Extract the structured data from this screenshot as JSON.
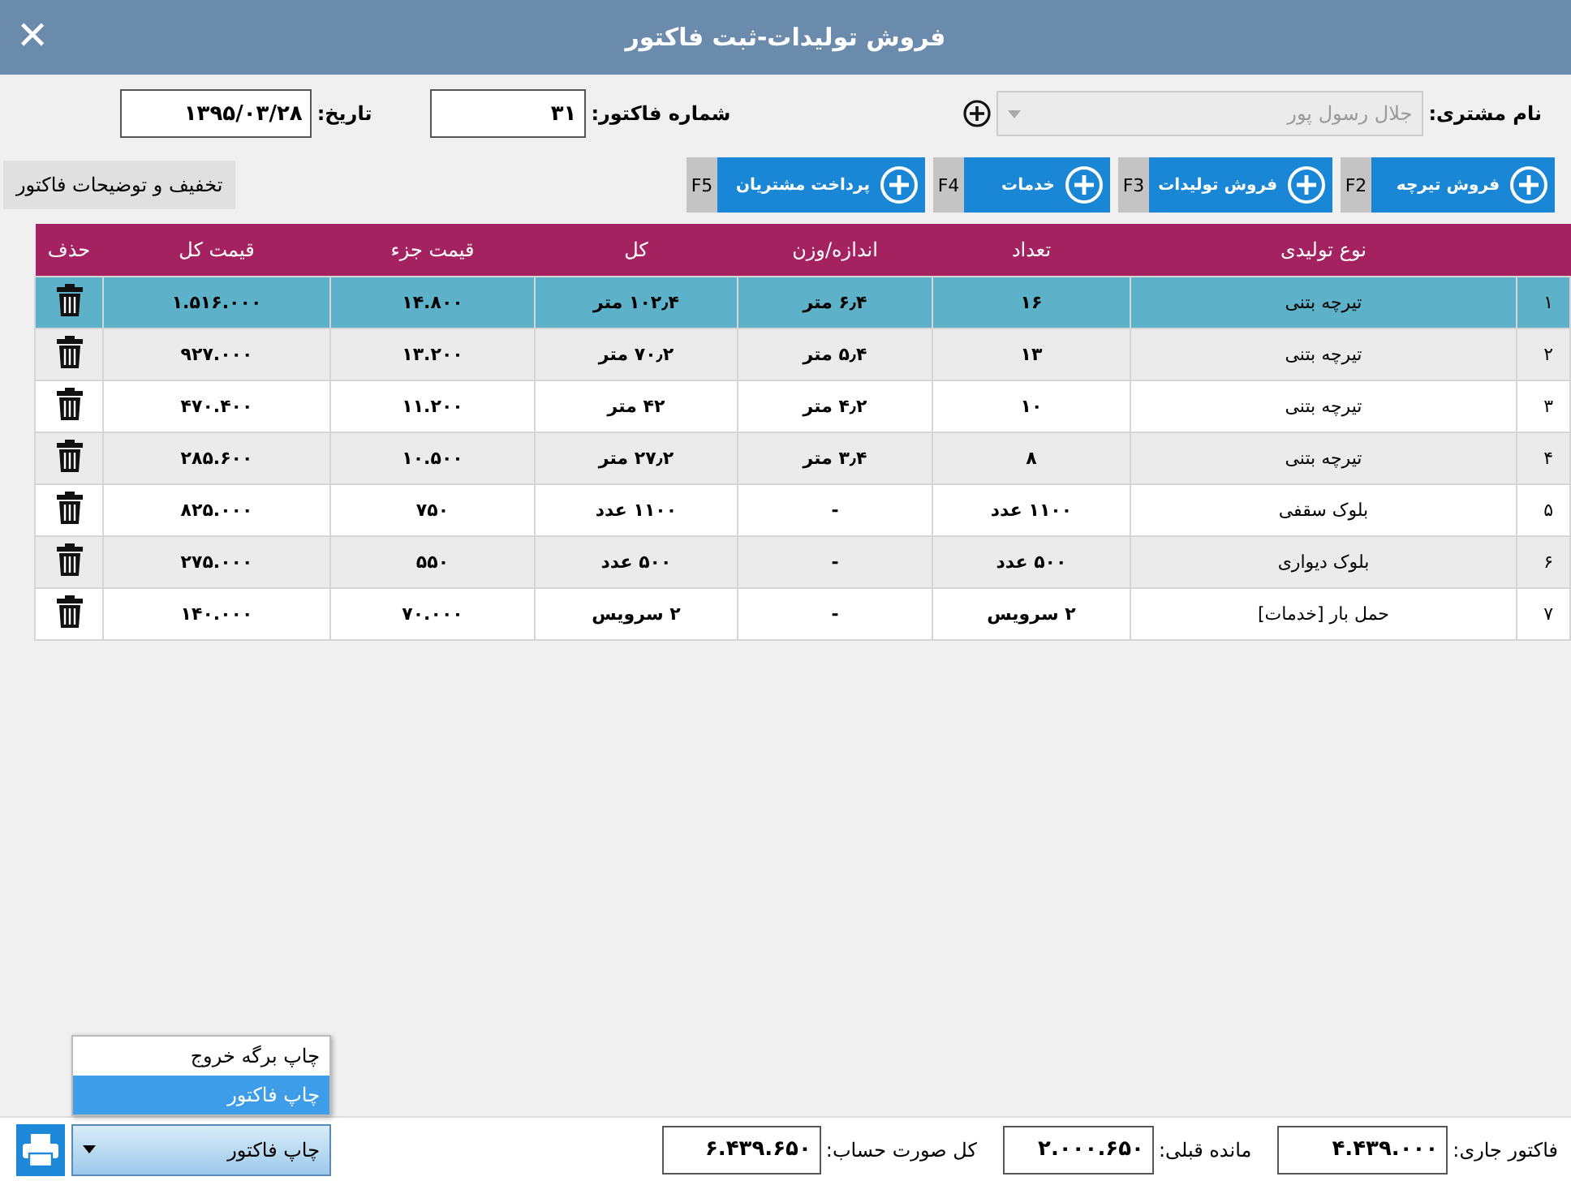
{
  "window": {
    "title": "فروش تولیدات-ثبت فاکتور",
    "close": "✕"
  },
  "form": {
    "customer": {
      "label": "نام مشتری:",
      "value": "جلال رسول پور",
      "disabled": true
    },
    "invoice_number": {
      "label": "شماره فاکتور:",
      "value": "۳۱"
    },
    "date": {
      "label": "تاریخ:",
      "value": "۱۳۹۵/۰۳/۲۸"
    }
  },
  "toolbar": {
    "buttons": [
      {
        "label": "فروش تیرچه",
        "key": "F2"
      },
      {
        "label": "فروش تولیدات",
        "key": "F3"
      },
      {
        "label": "خدمات",
        "key": "F4"
      },
      {
        "label": "پرداخت مشتریان",
        "key": "F5"
      }
    ],
    "discount_button": "تخفیف و توضیحات فاکتور"
  },
  "table": {
    "columns": [
      "",
      "نوع تولیدی",
      "تعداد",
      "اندازه/وزن",
      "کل",
      "قیمت جزء",
      "قیمت کل",
      "حذف"
    ],
    "rows": [
      {
        "selected": true,
        "cells": [
          "۱",
          "تیرچه بتنی",
          "۱۶",
          "۶٫۴ متر",
          "۱۰۲٫۴ متر",
          "۱۴.۸۰۰",
          "۱.۵۱۶.۰۰۰"
        ]
      },
      {
        "selected": false,
        "cells": [
          "۲",
          "تیرچه بتنی",
          "۱۳",
          "۵٫۴ متر",
          "۷۰٫۲ متر",
          "۱۳.۲۰۰",
          "۹۲۷.۰۰۰"
        ]
      },
      {
        "selected": false,
        "cells": [
          "۳",
          "تیرچه بتنی",
          "۱۰",
          "۴٫۲ متر",
          "۴۲ متر",
          "۱۱.۲۰۰",
          "۴۷۰.۴۰۰"
        ]
      },
      {
        "selected": false,
        "cells": [
          "۴",
          "تیرچه بتنی",
          "۸",
          "۳٫۴ متر",
          "۲۷٫۲ متر",
          "۱۰.۵۰۰",
          "۲۸۵.۶۰۰"
        ]
      },
      {
        "selected": false,
        "cells": [
          "۵",
          "بلوک سقفی",
          "۱۱۰۰ عدد",
          "-",
          "۱۱۰۰ عدد",
          "۷۵۰",
          "۸۲۵.۰۰۰"
        ]
      },
      {
        "selected": false,
        "cells": [
          "۶",
          "بلوک دیواری",
          "۵۰۰ عدد",
          "-",
          "۵۰۰ عدد",
          "۵۵۰",
          "۲۷۵.۰۰۰"
        ]
      },
      {
        "selected": false,
        "cells": [
          "۷",
          "حمل بار [خدمات]",
          "۲ سرویس",
          "-",
          "۲ سرویس",
          "۷۰.۰۰۰",
          "۱۴۰.۰۰۰"
        ]
      }
    ]
  },
  "footer": {
    "print_menu": [
      {
        "label": "چاپ برگه خروج",
        "selected": false
      },
      {
        "label": "چاپ فاکتور",
        "selected": true
      }
    ],
    "print_dropdown": "چاپ فاکتور",
    "totals": [
      {
        "label": "فاکتور جاری:",
        "value": "۴.۴۳۹.۰۰۰"
      },
      {
        "label": "مانده قبلی:",
        "value": "۲.۰۰۰.۶۵۰"
      },
      {
        "label": "کل صورت حساب:",
        "value": "۶.۴۳۹.۶۵۰"
      }
    ]
  }
}
